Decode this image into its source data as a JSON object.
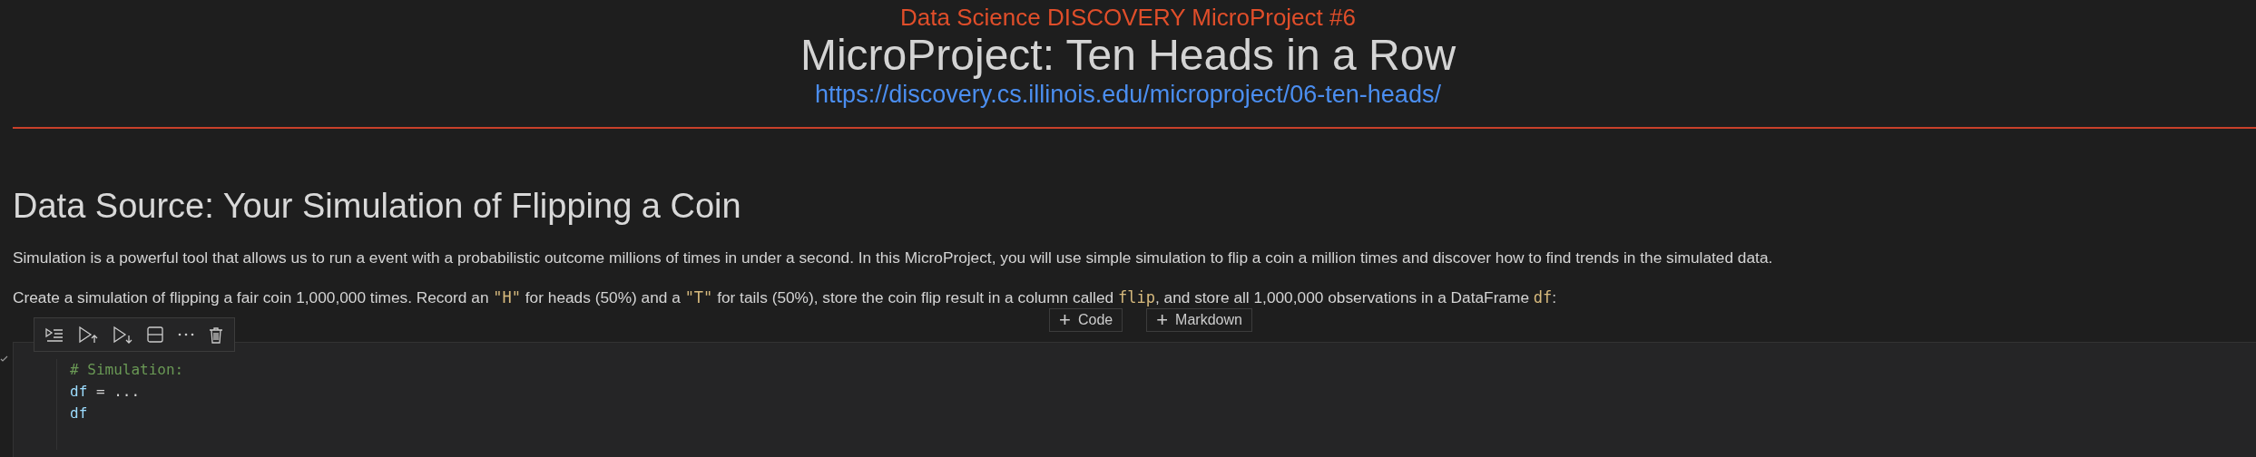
{
  "header": {
    "subtitle": "Data Science DISCOVERY MicroProject #6",
    "title": "MicroProject: Ten Heads in a Row",
    "url": "https://discovery.cs.illinois.edu/microproject/06-ten-heads/"
  },
  "section": {
    "heading": "Data Source: Your Simulation of Flipping a Coin",
    "paragraphs": [
      [
        {
          "text": "Simulation is a powerful tool that allows us to run a event with a probabilistic outcome millions of times in under a second. In this MicroProject, you will use simple simulation to flip a coin a million times and discover how to find trends in the simulated data.",
          "code": false
        }
      ],
      [
        {
          "text": "Create a simulation of flipping a fair coin 1,000,000 times. Record an ",
          "code": false
        },
        {
          "text": "\"H\"",
          "code": true
        },
        {
          "text": " for heads (50%) and a ",
          "code": false
        },
        {
          "text": "\"T\"",
          "code": true
        },
        {
          "text": " for tails (50%), store the coin flip result in a column called ",
          "code": false
        },
        {
          "text": "flip",
          "code": true
        },
        {
          "text": ", and store all 1,000,000 observations in a DataFrame ",
          "code": false
        },
        {
          "text": "df",
          "code": true
        },
        {
          "text": ":",
          "code": false
        }
      ]
    ]
  },
  "add_buttons": [
    {
      "icon": "+",
      "label": "Code"
    },
    {
      "icon": "+",
      "label": "Markdown"
    }
  ],
  "cell_toolbar": [
    {
      "kind": "run-by-line"
    },
    {
      "kind": "run-above"
    },
    {
      "kind": "run-below"
    },
    {
      "kind": "split"
    },
    {
      "kind": "more"
    },
    {
      "kind": "delete"
    }
  ],
  "code_cell": {
    "lines": [
      [
        {
          "text": "# Simulation:",
          "kind": "comment"
        }
      ],
      [
        {
          "text": "df",
          "kind": "var"
        },
        {
          "text": " = ...",
          "kind": "plain"
        }
      ],
      [
        {
          "text": "df",
          "kind": "var"
        }
      ]
    ]
  }
}
